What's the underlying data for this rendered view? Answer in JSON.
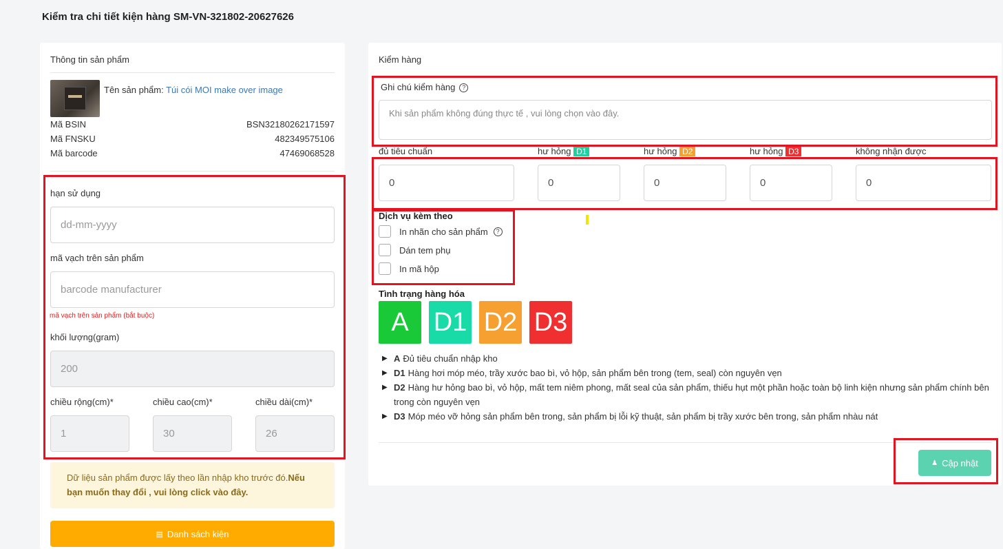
{
  "page": {
    "title": "Kiểm tra chi tiết kiện hàng SM-VN-321802-20627626"
  },
  "product_info": {
    "title": "Thông tin sản phẩm",
    "name_label": "Tên sản phẩm:",
    "name_value": "Túi cói MOI make over image",
    "rows": [
      {
        "label": "Mã BSIN",
        "value": "BSN32180262171597"
      },
      {
        "label": "Mã FNSKU",
        "value": "482349575106"
      },
      {
        "label": "Mã barcode",
        "value": "47469068528"
      }
    ]
  },
  "form": {
    "expiry_label": "hạn sử dụng",
    "expiry_placeholder": "dd-mm-yyyy",
    "barcode_label": "mã vạch trên sản phẩm",
    "barcode_placeholder": "barcode manufacturer",
    "barcode_required": "mã vạch trên sản phẩm (bắt buộc)",
    "weight_label": "khối lượng(gram)",
    "weight_value": "200",
    "width_label": "chiều rộng(cm)*",
    "width_value": "1",
    "height_label": "chiều cao(cm)*",
    "height_value": "30",
    "length_label": "chiều dài(cm)*",
    "length_value": "26"
  },
  "notice": {
    "text": "Dữ liệu sản phẩm được lấy theo lần nhập kho trước đó.",
    "bold": "Nếu bạn muốn thay đổi , vui lòng click vào đây."
  },
  "list_button": {
    "label": "Danh sách kiện",
    "icon": "list-icon"
  },
  "inspection": {
    "title": "Kiểm hàng",
    "note_label": "Ghi chú kiểm hàng",
    "note_placeholder": "Khi sản phẩm không đúng thực tế , vui lòng chọn vào đây.",
    "quantities": [
      {
        "label": "đủ tiêu chuẩn",
        "tag": "",
        "value": "0"
      },
      {
        "label": "hư hỏng",
        "tag": "D1",
        "value": "0"
      },
      {
        "label": "hư hỏng",
        "tag": "D2",
        "value": "0"
      },
      {
        "label": "hư hỏng",
        "tag": "D3",
        "value": "0"
      },
      {
        "label": "không nhận được",
        "tag": "",
        "value": "0"
      }
    ],
    "services_title": "Dịch vụ kèm theo",
    "services": [
      "In nhãn cho sản phẩm",
      "Dán tem phụ",
      "In mã hộp"
    ],
    "status_title": "Tình trạng hàng hóa",
    "grades": [
      "A",
      "D1",
      "D2",
      "D3"
    ],
    "definitions": [
      {
        "code": "A",
        "text": "Đủ tiêu chuẩn nhập kho"
      },
      {
        "code": "D1",
        "text": "Hàng hơi móp méo, trầy xước bao bì, vỏ hộp, sản phẩm bên trong (tem, seal) còn nguyên vẹn"
      },
      {
        "code": "D2",
        "text": "Hàng hư hỏng bao bì, vỏ hộp, mất tem niêm phong, mất seal của sản phẩm, thiếu hụt một phần hoặc toàn bộ linh kiện nhưng sản phẩm chính bên trong còn nguyên vẹn"
      },
      {
        "code": "D3",
        "text": "Móp méo vỡ hỏng sản phẩm bên trong, sản phẩm bị lỗi kỹ thuật, sản phẩm bị trầy xước bên trong, sản phẩm nhàu nát"
      }
    ],
    "update_button": "Cập nhật"
  },
  "colors": {
    "highlight": "#e3141f",
    "grade_a": "#19c938",
    "grade_d1": "#18dba8",
    "grade_d2": "#f5a030",
    "grade_d3": "#f03030",
    "primary_orange": "#ffab00",
    "update_green": "#5cd3b0"
  }
}
